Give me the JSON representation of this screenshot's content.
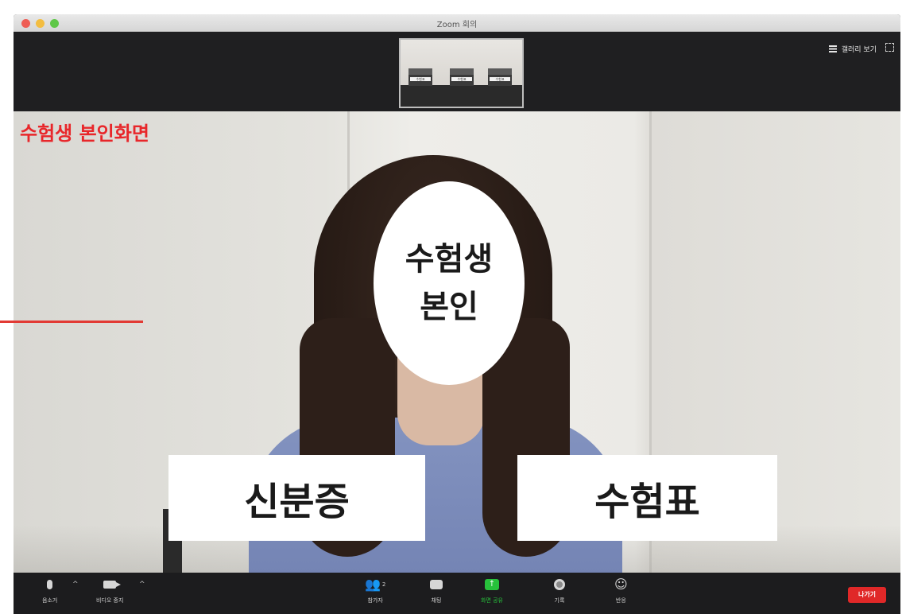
{
  "window": {
    "title": "Zoom 회의"
  },
  "topbar": {
    "gallery_view_label": "갤러리 보기",
    "thumbnail_desks": [
      "수험표",
      "수험표",
      "수험표"
    ]
  },
  "video": {
    "self_view_label": "수험생 본인화면",
    "face_mask_line1": "수험생",
    "face_mask_line2": "본인",
    "id_card_label": "신분증",
    "exam_ticket_label": "수험표"
  },
  "toolbar": {
    "mute_label": "음소거",
    "video_label": "비디오 중지",
    "participants_label": "참가자",
    "participants_count": "2",
    "chat_label": "채팅",
    "share_label": "화면 공유",
    "record_label": "기록",
    "reactions_label": "반응",
    "leave_label": "나가기"
  },
  "colors": {
    "accent_red": "#e8262a",
    "share_green": "#27c13b",
    "leave_red": "#e02828",
    "toolbar_bg": "#1c1c1e"
  },
  "icons": [
    "mic-icon",
    "video-camera-icon",
    "participants-icon",
    "chat-icon",
    "share-screen-icon",
    "record-icon",
    "reactions-icon",
    "grid-icon",
    "fullscreen-icon"
  ]
}
